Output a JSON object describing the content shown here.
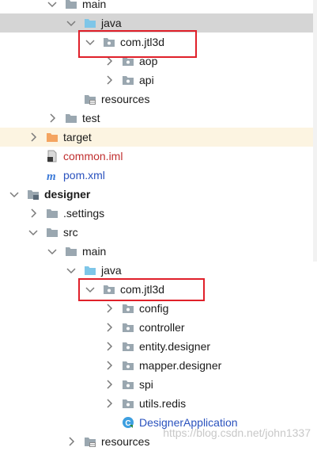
{
  "tree": [
    {
      "name": "tree-node-main-top",
      "label": "main",
      "level": 2,
      "expand": "open",
      "icon": "folder-gray",
      "style": ""
    },
    {
      "name": "tree-node-java-top",
      "label": "java",
      "level": 3,
      "expand": "open",
      "icon": "folder-blue",
      "style": "",
      "selected": true
    },
    {
      "name": "tree-node-package-top",
      "label": "com.jtl3d",
      "level": 4,
      "expand": "open",
      "icon": "package",
      "style": ""
    },
    {
      "name": "tree-node-aop",
      "label": "aop",
      "level": 5,
      "expand": "closed",
      "icon": "package",
      "style": ""
    },
    {
      "name": "tree-node-api",
      "label": "api",
      "level": 5,
      "expand": "closed",
      "icon": "package",
      "style": ""
    },
    {
      "name": "tree-node-resources-top",
      "label": "resources",
      "level": 3,
      "expand": "none",
      "icon": "folder-res",
      "style": ""
    },
    {
      "name": "tree-node-test",
      "label": "test",
      "level": 2,
      "expand": "closed",
      "icon": "folder-gray",
      "style": ""
    },
    {
      "name": "tree-node-target",
      "label": "target",
      "level": 1,
      "expand": "closed",
      "icon": "folder-orange",
      "style": "",
      "target": true
    },
    {
      "name": "tree-node-common-iml",
      "label": "common.iml",
      "level": 1,
      "expand": "none",
      "icon": "iml-file",
      "style": "red"
    },
    {
      "name": "tree-node-pom-xml",
      "label": "pom.xml",
      "level": 1,
      "expand": "none",
      "icon": "maven-file",
      "style": "blue"
    },
    {
      "name": "tree-node-designer",
      "label": "designer",
      "level": 0,
      "expand": "open",
      "icon": "module",
      "style": "bold"
    },
    {
      "name": "tree-node-settings",
      "label": ".settings",
      "level": 1,
      "expand": "closed",
      "icon": "folder-gray",
      "style": ""
    },
    {
      "name": "tree-node-src",
      "label": "src",
      "level": 1,
      "expand": "open",
      "icon": "folder-gray",
      "style": ""
    },
    {
      "name": "tree-node-main",
      "label": "main",
      "level": 2,
      "expand": "open",
      "icon": "folder-gray",
      "style": ""
    },
    {
      "name": "tree-node-java",
      "label": "java",
      "level": 3,
      "expand": "open",
      "icon": "folder-blue",
      "style": ""
    },
    {
      "name": "tree-node-package",
      "label": "com.jtl3d",
      "level": 4,
      "expand": "open",
      "icon": "package",
      "style": ""
    },
    {
      "name": "tree-node-config",
      "label": "config",
      "level": 5,
      "expand": "closed",
      "icon": "package",
      "style": ""
    },
    {
      "name": "tree-node-controller",
      "label": "controller",
      "level": 5,
      "expand": "closed",
      "icon": "package",
      "style": ""
    },
    {
      "name": "tree-node-entity-designer",
      "label": "entity.designer",
      "level": 5,
      "expand": "closed",
      "icon": "package",
      "style": ""
    },
    {
      "name": "tree-node-mapper-designer",
      "label": "mapper.designer",
      "level": 5,
      "expand": "closed",
      "icon": "package",
      "style": ""
    },
    {
      "name": "tree-node-spi",
      "label": "spi",
      "level": 5,
      "expand": "closed",
      "icon": "package",
      "style": ""
    },
    {
      "name": "tree-node-utils-redis",
      "label": "utils.redis",
      "level": 5,
      "expand": "closed",
      "icon": "package",
      "style": ""
    },
    {
      "name": "tree-node-designer-application",
      "label": "DesignerApplication",
      "level": 5,
      "expand": "none",
      "icon": "class-file",
      "style": "blue"
    },
    {
      "name": "tree-node-resources",
      "label": "resources",
      "level": 3,
      "expand": "closed",
      "icon": "folder-res",
      "style": ""
    }
  ],
  "watermark": "https://blog.csdn.net/john1337",
  "colors": {
    "selection": "#d5d5d5",
    "highlight_box": "#e0202a",
    "folder_gray": "#9aa7b0",
    "folder_blue": "#7ec6e8",
    "folder_orange": "#f4a460",
    "class_icon": "#3d9fe0"
  }
}
